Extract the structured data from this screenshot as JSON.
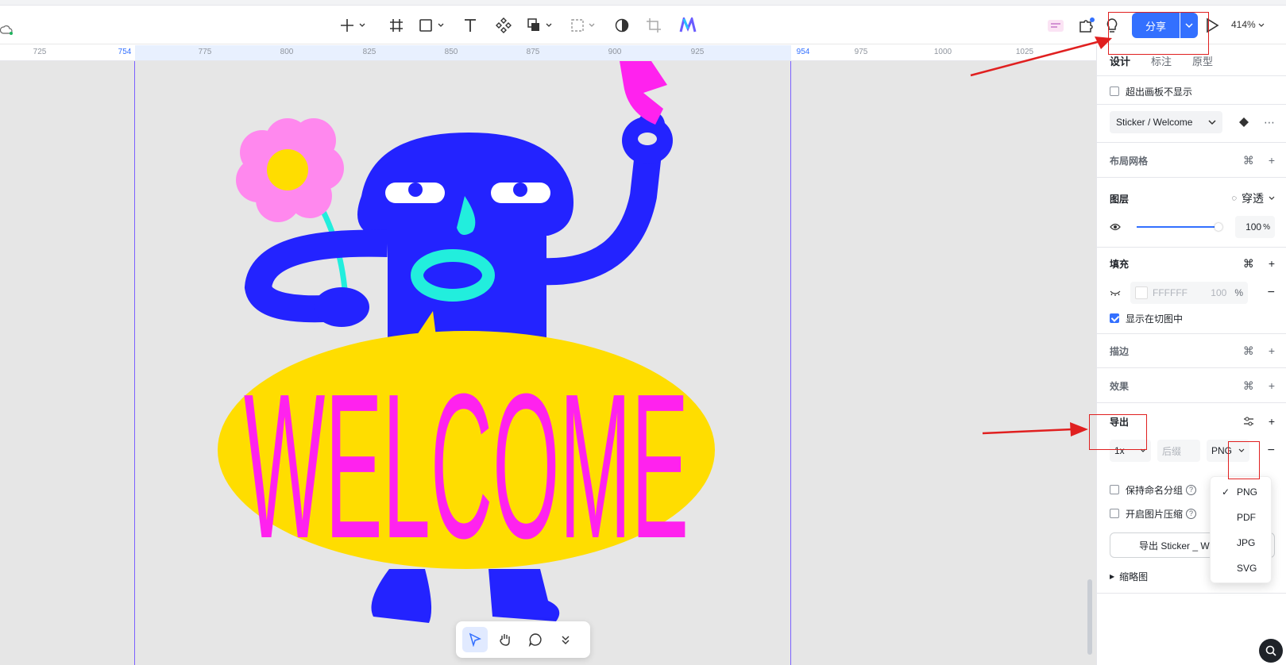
{
  "toolbar": {
    "share_label": "分享",
    "zoom_level": "414%"
  },
  "ruler": {
    "ticks": [
      "725",
      "754",
      "775",
      "800",
      "825",
      "850",
      "875",
      "900",
      "925",
      "954",
      "975",
      "1000",
      "1025"
    ]
  },
  "artwork": {
    "welcome_text": "WELCOME"
  },
  "panel": {
    "tabs": [
      "设计",
      "标注",
      "原型"
    ],
    "clip_content_label": "超出画板不显示",
    "component_name": "Sticker / Welcome",
    "layout_grid_label": "布局网格",
    "layer": {
      "title": "图层",
      "blend_mode": "穿透",
      "opacity": "100",
      "opacity_unit": "%"
    },
    "fill": {
      "title": "填充",
      "hex": "FFFFFF",
      "opacity": "100",
      "unit": "%",
      "show_in_slice_label": "显示在切图中"
    },
    "stroke_title": "描边",
    "effect_title": "效果",
    "export": {
      "title": "导出",
      "scale": "1x",
      "suffix_placeholder": "后缀",
      "format": "PNG",
      "keep_group_label": "保持命名分组",
      "compress_label": "开启图片压缩",
      "export_button": "导出 Sticker _ W",
      "thumbnail_label": "缩略图"
    },
    "format_menu": [
      "PNG",
      "PDF",
      "JPG",
      "SVG"
    ]
  },
  "colors": {
    "accent": "#3370ff",
    "guide": "#7b61ff",
    "character_blue": "#2323ff",
    "welcome_magenta": "#ff22ee",
    "oval_yellow": "#ffdd00",
    "cyan": "#22eedd",
    "petal_pink": "#ff88ee"
  }
}
